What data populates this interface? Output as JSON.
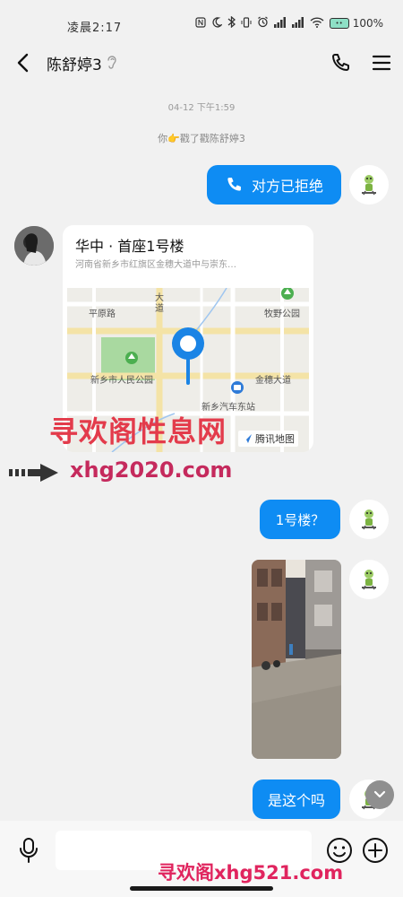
{
  "status_bar": {
    "time": "凌晨2:17",
    "battery_percent": "100%",
    "icons": [
      "nfc-icon",
      "moon-icon",
      "bluetooth-icon",
      "vibrate-icon",
      "alarm-icon",
      "signal-icon",
      "signal-icon",
      "wifi-icon",
      "battery-icon"
    ]
  },
  "header": {
    "contact_name": "陈舒婷3",
    "icons": [
      "back-icon",
      "ear-icon",
      "phone-icon",
      "menu-icon"
    ]
  },
  "chat": {
    "timestamp": "04-12 下午1:59",
    "poke_text": "你👉戳了戳陈舒婷3",
    "messages": [
      {
        "type": "call",
        "text": "对方已拒绝",
        "sender": "self"
      },
      {
        "type": "location",
        "sender": "other",
        "title": "华中 · 首座1号楼",
        "address": "河南省新乡市红旗区金穗大道中与崇东…",
        "map": {
          "labels": [
            "平原路",
            "大道",
            "牧野公园",
            "新乡市人民公园",
            "金穗大道",
            "新乡汽车东站"
          ],
          "brand": "腾讯地图"
        }
      },
      {
        "type": "text",
        "text": "1号楼？",
        "sender": "self"
      },
      {
        "type": "image",
        "sender": "self"
      },
      {
        "type": "text",
        "text": "是这个吗",
        "sender": "self"
      }
    ]
  },
  "watermarks": {
    "main": "寻欢阁性息网",
    "url": "xhg2020.com",
    "bottom": "寻欢阁xhg521.com"
  },
  "input": {
    "placeholder": ""
  },
  "colors": {
    "bubble": "#0e8cf3",
    "background": "#f1f1f1"
  }
}
